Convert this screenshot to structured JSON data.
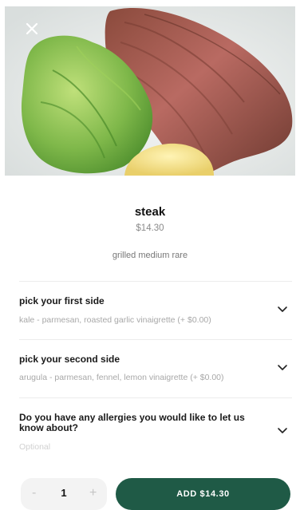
{
  "dish": {
    "name": "steak",
    "price": "$14.30",
    "description": "grilled medium rare"
  },
  "options": [
    {
      "title": "pick your first side",
      "value": "kale - parmesan, roasted garlic vinaigrette (+ $0.00)"
    },
    {
      "title": "pick your second side",
      "value": "arugula - parmesan, fennel, lemon vinaigrette (+ $0.00)"
    },
    {
      "title_line1": "Do you have any allergies you would like to let us",
      "title_line2": "know about?",
      "placeholder": "Optional"
    }
  ],
  "quantity": {
    "minus": "-",
    "value": "1",
    "plus": "+"
  },
  "add_button": {
    "label": "ADD $14.30"
  },
  "colors": {
    "accent": "#1f5a46",
    "muted_text": "#a8a8a8"
  },
  "icons": {
    "close": "close-icon",
    "chevron": "chevron-down-icon"
  }
}
